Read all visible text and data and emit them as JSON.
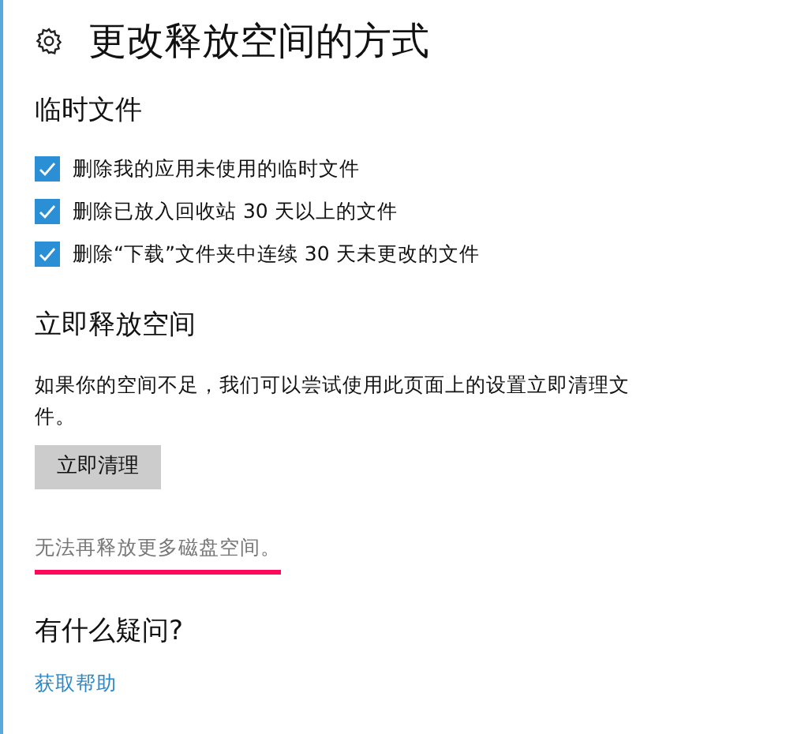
{
  "title": "更改释放空间的方式",
  "sections": [
    {
      "kind": "checklist",
      "heading": "临时文件",
      "items": [
        {
          "label": "删除我的应用未使用的临时文件",
          "checked": true
        },
        {
          "label": "删除已放入回收站 30 天以上的文件",
          "checked": true
        },
        {
          "label": "删除“下载”文件夹中连续 30 天未更改的文件",
          "checked": true
        }
      ]
    },
    {
      "kind": "action",
      "heading": "立即释放空间",
      "description": "如果你的空间不足，我们可以尝试使用此页面上的设置立即清理文件。",
      "button": "立即清理",
      "status": "无法再释放更多磁盘空间。",
      "status_underlined": true
    },
    {
      "kind": "help",
      "heading": "有什么疑问?",
      "link": "获取帮助"
    }
  ]
}
